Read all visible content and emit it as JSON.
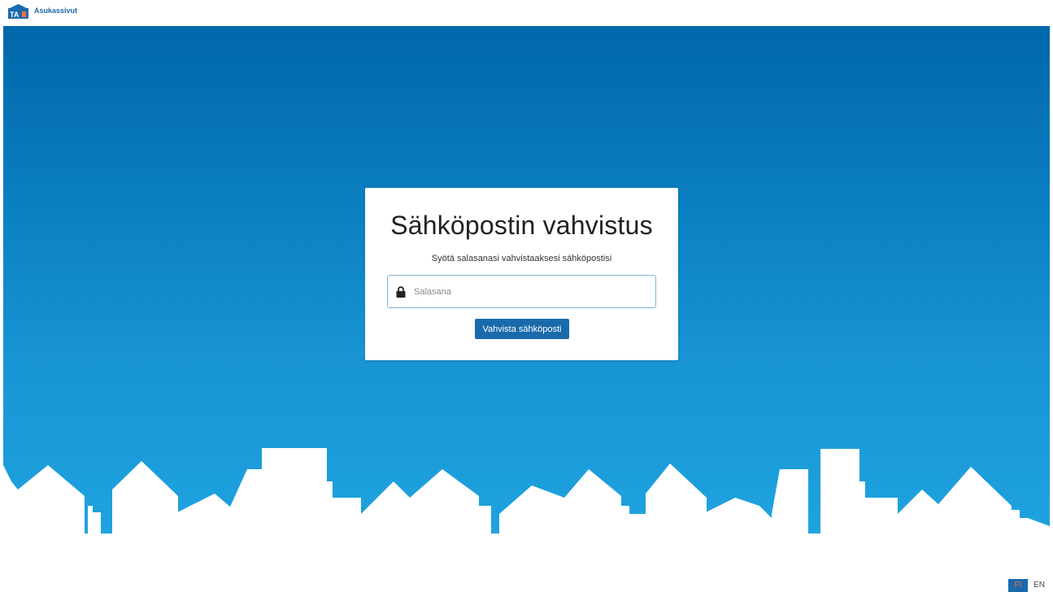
{
  "header": {
    "logo_text": "TA",
    "brand": "Asukassivut"
  },
  "card": {
    "title": "Sähköpostin vahvistus",
    "subtitle": "Syötä salasanasi vahvistaaksesi sähköpostisi",
    "password": {
      "placeholder": "Salasana",
      "value": "",
      "icon": "lock-icon"
    },
    "confirm_label": "Vahvista sähköposti"
  },
  "language": {
    "options": [
      "FI",
      "EN"
    ],
    "selected": "FI"
  },
  "colors": {
    "brand_blue": "#1a6aab",
    "hero_top": "#0067ab",
    "hero_bottom": "#1ea3df",
    "accent_orange": "#ff6b3d"
  }
}
